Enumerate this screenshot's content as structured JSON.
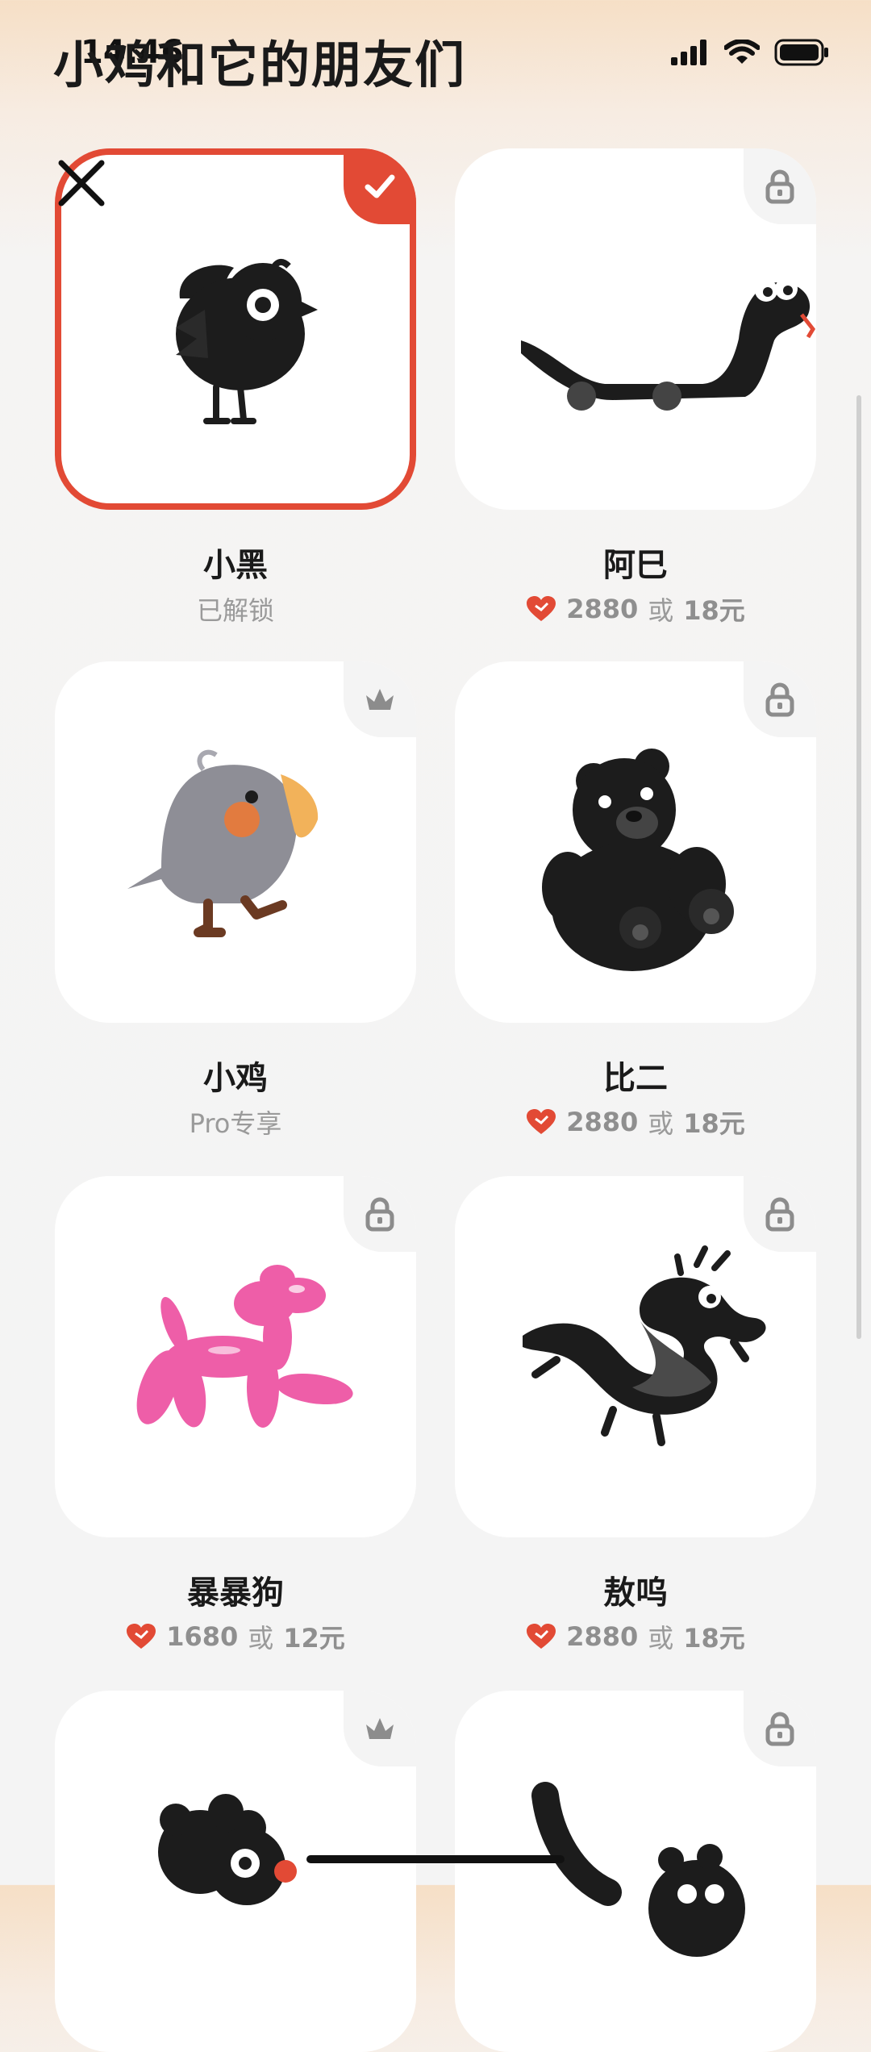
{
  "status_bar": {
    "time": "14:46",
    "signal_icon": "signal-bars-icon",
    "wifi_icon": "wifi-icon",
    "battery_icon": "battery-icon"
  },
  "page": {
    "title": "小鸡和它的朋友们",
    "close_icon": "close-icon"
  },
  "colors": {
    "accent": "#e24a35",
    "card": "#ffffff",
    "muted": "#9a9a9a"
  },
  "characters": [
    {
      "name": "小黑",
      "status": "已解锁",
      "badge_icon": "check-icon",
      "selected": true
    },
    {
      "name": "阿巳",
      "price": "2880",
      "or": "或",
      "money": "18元",
      "badge_icon": "lock-icon"
    },
    {
      "name": "小鸡",
      "status": "Pro专享",
      "badge_icon": "crown-icon"
    },
    {
      "name": "比二",
      "price": "2880",
      "or": "或",
      "money": "18元",
      "badge_icon": "lock-icon"
    },
    {
      "name": "暴暴狗",
      "price": "1680",
      "or": "或",
      "money": "12元",
      "badge_icon": "lock-icon"
    },
    {
      "name": "敖呜",
      "price": "2880",
      "or": "或",
      "money": "18元",
      "badge_icon": "lock-icon"
    },
    {
      "name": "",
      "badge_icon": "crown-icon"
    },
    {
      "name": "",
      "badge_icon": "lock-icon"
    }
  ]
}
